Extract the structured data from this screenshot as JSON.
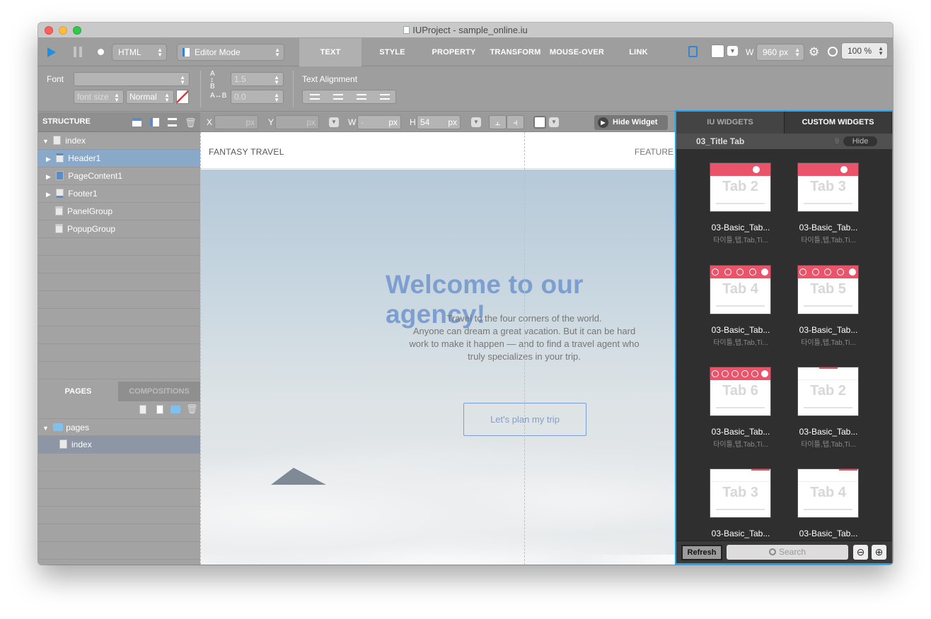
{
  "window": {
    "title": "IUProject - sample_online.iu"
  },
  "toolbar": {
    "language": "HTML",
    "mode": "Editor Mode",
    "tabs": [
      "TEXT",
      "STYLE",
      "PROPERTY",
      "TRANSFORM",
      "MOUSE-OVER",
      "LINK"
    ],
    "width_label": "W",
    "width_value": "960 px",
    "zoom_value": "100 %"
  },
  "text_props": {
    "font_label": "Font",
    "font_size_placeholder": "font size",
    "weight": "Normal",
    "line_height": "1.5",
    "letter_spacing": "0.0",
    "alignment_label": "Text Alignment"
  },
  "structure": {
    "title": "STRUCTURE",
    "items": [
      {
        "label": "index"
      },
      {
        "label": "Header1"
      },
      {
        "label": "PageContent1"
      },
      {
        "label": "Footer1"
      },
      {
        "label": "PanelGroup"
      },
      {
        "label": "PopupGroup"
      }
    ]
  },
  "pages_panel": {
    "tabs": [
      "PAGES",
      "COMPOSITIONS"
    ],
    "folder": "pages",
    "page": "index"
  },
  "canvas_bar": {
    "x_label": "X",
    "y_label": "Y",
    "w_label": "W",
    "h_label": "H",
    "unit": "px",
    "w_value": "-",
    "h_value": "54",
    "hide_widget": "Hide Widget"
  },
  "site": {
    "brand": "FANTASY TRAVEL",
    "nav": "FEATURE",
    "headline": "Welcome to our agency!",
    "body_lines": [
      "Travel to the four corners of the world.",
      "Anyone can dream a great vacation. But it can be hard",
      "work to make it happen — and to find a travel agent who",
      "truly specializes in your trip."
    ],
    "cta": "Let's plan my trip"
  },
  "widgets": {
    "tabs": [
      "IU WIDGETS",
      "CUSTOM WIDGETS"
    ],
    "category": "03_Title Tab",
    "count": "9",
    "hide": "Hide",
    "items": [
      {
        "big": "Tab 2",
        "name": "03-Basic_Tab...",
        "sub": "타이틀,탭,Tab,Ti..."
      },
      {
        "big": "Tab 3",
        "name": "03-Basic_Tab...",
        "sub": "타이틀,탭,Tab,Ti..."
      },
      {
        "big": "Tab 4",
        "name": "03-Basic_Tab...",
        "sub": "타이틀,탭,Tab,Ti..."
      },
      {
        "big": "Tab 5",
        "name": "03-Basic_Tab...",
        "sub": "타이틀,탭,Tab,Ti..."
      },
      {
        "big": "Tab 6",
        "name": "03-Basic_Tab...",
        "sub": "타이틀,탭,Tab,Ti..."
      },
      {
        "big": "Tab 2",
        "name": "03-Basic_Tab...",
        "sub": "타이틀,탭,Tab,Ti..."
      },
      {
        "big": "Tab 3",
        "name": "03-Basic_Tab...",
        "sub": ""
      },
      {
        "big": "Tab 4",
        "name": "03-Basic_Tab...",
        "sub": ""
      }
    ],
    "refresh": "Refresh",
    "search_placeholder": "Search"
  },
  "colors": {
    "accent": "#1fa2f2",
    "widget_red": "#e9546b",
    "headline_blue": "#7d9fcf"
  }
}
